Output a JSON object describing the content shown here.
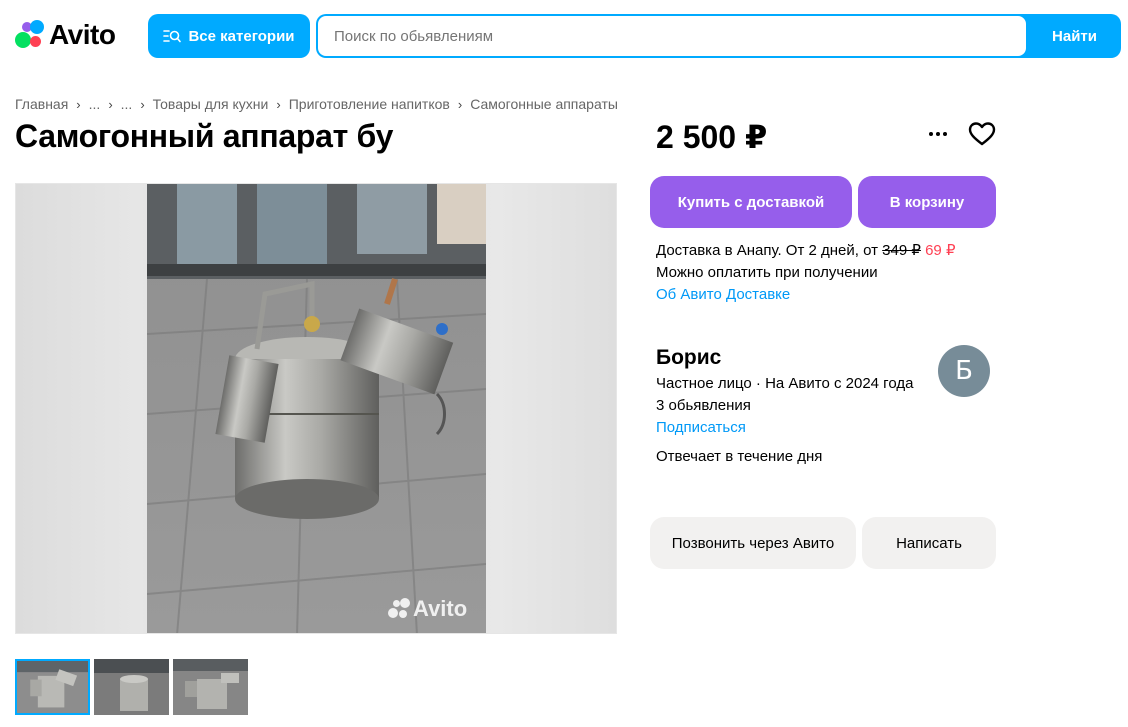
{
  "header": {
    "logo_text": "Avito",
    "categories_label": "Все категории",
    "search": {
      "placeholder": "Поиск по обьявлениям",
      "button_label": "Найти"
    }
  },
  "breadcrumbs": [
    "Главная",
    "...",
    "...",
    "Товары для кухни",
    "Приготовление напитков",
    "Самогонные аппараты"
  ],
  "listing": {
    "title": "Самогонный аппарат бу",
    "price": "2 500 ₽",
    "watermark": "Avito",
    "buy_label": "Купить с доставкой",
    "cart_label": "В корзину",
    "delivery": {
      "line1_prefix": "Доставка в Анапу. От 2 дней, от ",
      "old_price": "349 ₽",
      "new_price": "69 ₽",
      "line2": "Можно оплатить при получении",
      "link": "Об Авито Доставке"
    }
  },
  "seller": {
    "name": "Борис",
    "avatar_letter": "Б",
    "info": "Частное лицо · На Авито с 2024 года",
    "ads_count": "3 обьявления",
    "subscribe": "Подписаться",
    "responds": "Отвечает в течение дня"
  },
  "actions": {
    "call_label": "Позвонить через Авито",
    "write_label": "Написать"
  },
  "icons": [
    "categories-icon",
    "more-icon",
    "heart-icon"
  ],
  "colors": {
    "brand_blue": "#00aaff",
    "purple": "#965eeb",
    "link": "#0099f7",
    "sale_red": "#ff4053",
    "gray_btn": "#f2f1f0"
  }
}
